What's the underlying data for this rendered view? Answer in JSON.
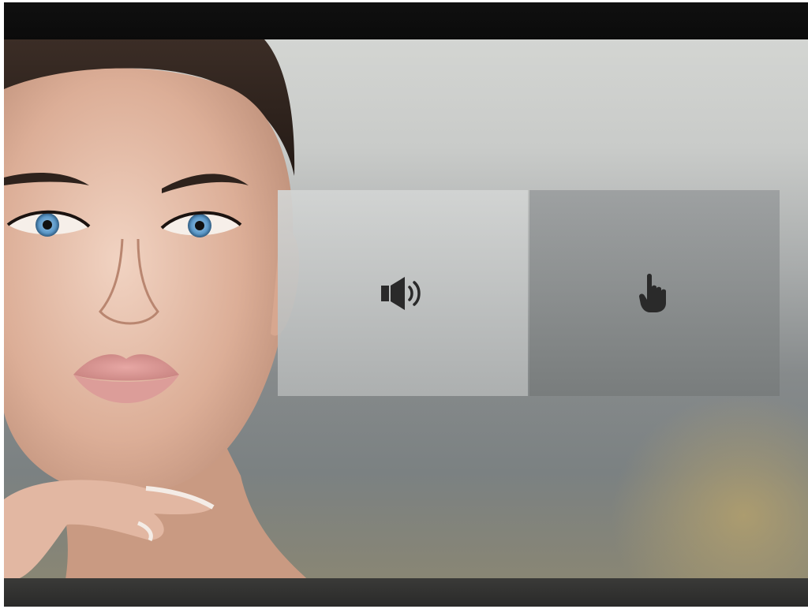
{
  "top_bar": {},
  "tiles": [
    {
      "icon": "speaker-icon"
    },
    {
      "icon": "pointer-hand-icon"
    }
  ],
  "colors": {
    "top_bar": "#0e0e0e",
    "bottom_bar": "#323231",
    "tile_light": "#c4c6c5",
    "tile_dark": "#8b8f90",
    "icon": "#2a2a2a"
  }
}
